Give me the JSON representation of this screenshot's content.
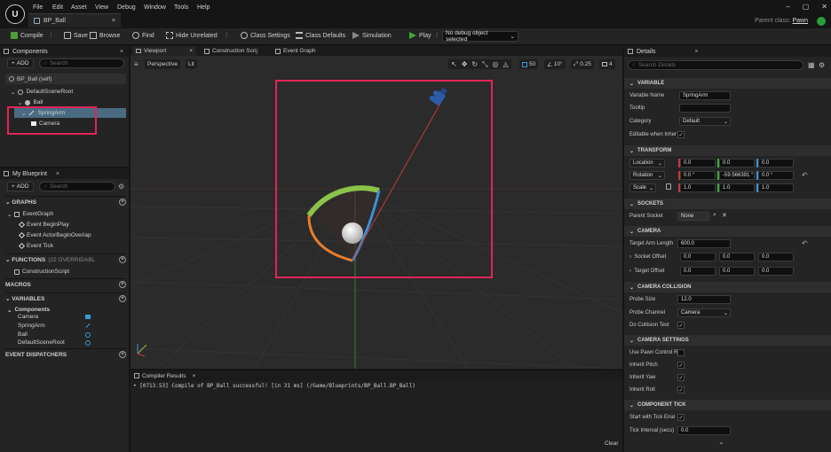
{
  "menu": [
    "File",
    "Edit",
    "Asset",
    "View",
    "Debug",
    "Window",
    "Tools",
    "Help"
  ],
  "doc_tab": {
    "label": "BP_Ball",
    "close": "×"
  },
  "window_controls": [
    "–",
    "▢",
    "✕"
  ],
  "parent_class": {
    "label": "Parent class:",
    "value": "Pawn"
  },
  "toolbar": {
    "compile": "Compile",
    "save": "Save",
    "browse": "Browse",
    "find": "Find",
    "hide_unrelated": "Hide Unrelated",
    "class_settings": "Class Settings",
    "class_defaults": "Class Defaults",
    "simulation": "Simulation",
    "play": "Play",
    "debug_select": "No debug object selected"
  },
  "components_panel": {
    "title": "Components",
    "add": "ADD",
    "search_placeholder": "Search",
    "self": "BP_Ball (self)",
    "tree": [
      "DefaultSceneRoot",
      "Ball",
      "SpringArm",
      "Camera"
    ]
  },
  "blueprint_panel": {
    "title": "My Blueprint",
    "add": "ADD",
    "search_placeholder": "Search",
    "graphs_label": "GRAPHS",
    "event_graph": "EventGraph",
    "events": [
      "Event BeginPlay",
      "Event ActorBeginOverlap",
      "Event Tick"
    ],
    "functions_label": "FUNCTIONS",
    "functions_override": "(22 OVERRIDABL",
    "construction_script": "ConstructionScript",
    "macros_label": "MACROS",
    "variables_label": "VARIABLES",
    "components_label": "Components",
    "variables": [
      "Camera",
      "SpringArm",
      "Ball",
      "DefaultSceneRoot"
    ],
    "event_dispatchers_label": "EVENT DISPATCHERS"
  },
  "editor_tabs": [
    "Viewport",
    "Construction Scrij",
    "Event Graph"
  ],
  "viewport": {
    "perspective": "Perspective",
    "lit": "Lit",
    "grid_snap": "50",
    "rotation_snap": "10°",
    "scale_snap": "0.25",
    "camera_speed": "4"
  },
  "compiler": {
    "title": "Compiler Results",
    "message": "• [0713.53] Compile of BP_Ball successful! [in 31 ms] (/Game/Blueprints/BP_Ball.BP_Ball)",
    "clear": "Clear"
  },
  "details": {
    "title": "Details",
    "search_placeholder": "Search Details",
    "variable_section": "VARIABLE",
    "variable_name_label": "Variable Name",
    "variable_name": "SpringArm",
    "tooltip_label": "Tooltip",
    "category_label": "Category",
    "category": "Default",
    "editable_label": "Editable when Inher",
    "transform_section": "TRANSFORM",
    "location_label": "Location",
    "location": [
      "0.0",
      "0.0",
      "0.0"
    ],
    "rotation_label": "Rotation",
    "rotation": [
      "0.0 °",
      "-59.566391 °",
      "0.0 °"
    ],
    "scale_label": "Scale",
    "scale": [
      "1.0",
      "1.0",
      "1.0"
    ],
    "sockets_section": "SOCKETS",
    "parent_socket_label": "Parent Socket",
    "parent_socket": "None",
    "camera_section": "CAMERA",
    "target_arm_label": "Target Arm Length",
    "target_arm": "600.0",
    "socket_offset_label": "Socket Offset",
    "socket_offset": [
      "0.0",
      "0.0",
      "0.0"
    ],
    "target_offset_label": "Target Offset",
    "target_offset": [
      "0.0",
      "0.0",
      "0.0"
    ],
    "camera_collision_section": "CAMERA COLLISION",
    "probe_size_label": "Probe Size",
    "probe_size": "12.0",
    "probe_channel_label": "Probe Channel",
    "probe_channel": "Camera",
    "do_collision_label": "Do Collision Test",
    "camera_settings_section": "CAMERA SETTINGS",
    "use_pawn_label": "Use Pawn Control R",
    "inherit_pitch_label": "Inherit Pitch",
    "inherit_yaw_label": "Inherit Yaw",
    "inherit_roll_label": "Inherit Roll",
    "component_tick_section": "COMPONENT TICK",
    "start_tick_label": "Start with Tick Enal",
    "tick_interval_label": "Tick Interval (secs)",
    "tick_interval": "0.0"
  },
  "colors": {
    "highlight": "#e2245a",
    "selected_row": "#4a6b82",
    "play_green": "#3ea83a"
  }
}
